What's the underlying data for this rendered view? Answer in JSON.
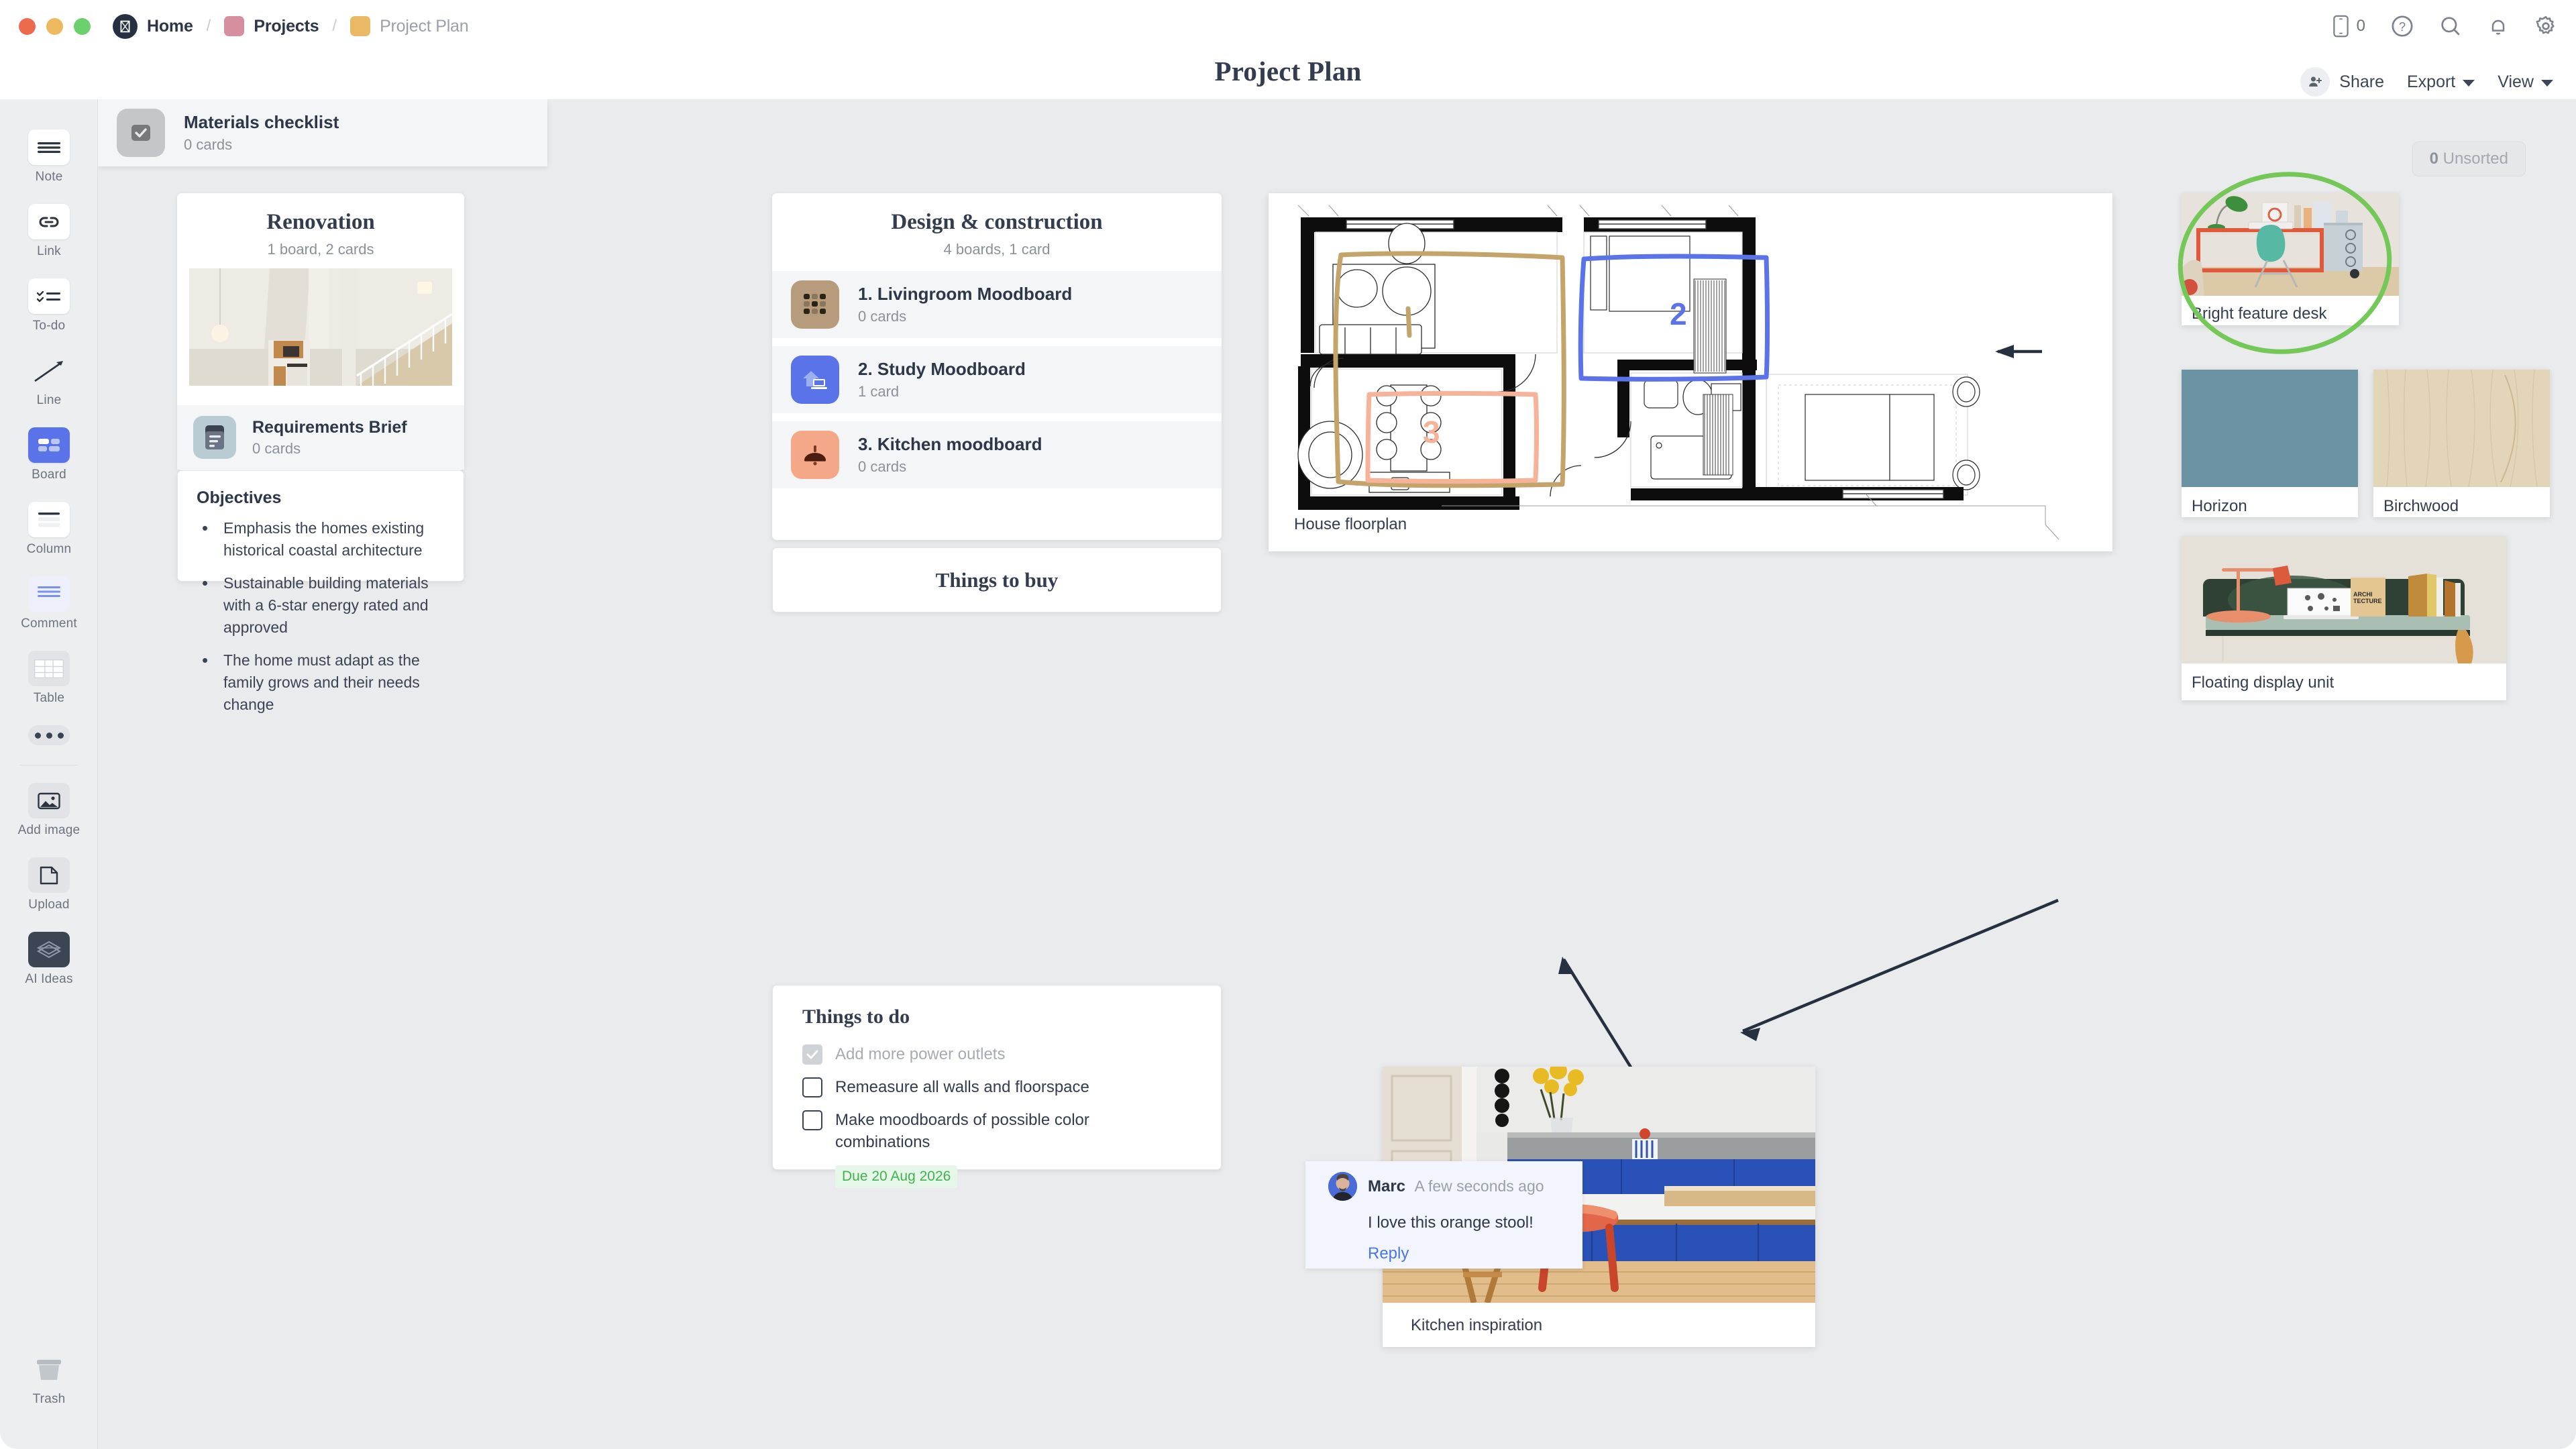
{
  "window": {
    "traffic_lights": [
      "close",
      "minimize",
      "maximize"
    ]
  },
  "breadcrumb": {
    "items": [
      {
        "label": "Home",
        "icon": "app-logo-icon",
        "color": "#263040",
        "dim": false
      },
      {
        "label": "Projects",
        "icon": "folder-square-icon",
        "color": "#d58f9e",
        "dim": false
      },
      {
        "label": "Project Plan",
        "icon": "folder-square-icon",
        "color": "#eab965",
        "dim": true
      }
    ],
    "separator": "/"
  },
  "topbar": {
    "device_count": "0",
    "icons": [
      "mobile-preview-icon",
      "help-icon",
      "search-icon",
      "notifications-icon",
      "settings-icon"
    ]
  },
  "header": {
    "title": "Project Plan",
    "share_label": "Share",
    "export_label": "Export",
    "view_label": "View"
  },
  "toolbar": {
    "items": [
      {
        "label": "Note",
        "icon": "note-icon",
        "active": false
      },
      {
        "label": "Link",
        "icon": "link-icon",
        "active": false
      },
      {
        "label": "To-do",
        "icon": "todo-icon",
        "active": false
      },
      {
        "label": "Line",
        "icon": "line-icon",
        "active": false
      },
      {
        "label": "Board",
        "icon": "board-icon",
        "active": true
      },
      {
        "label": "Column",
        "icon": "column-icon",
        "active": false
      },
      {
        "label": "Comment",
        "icon": "comment-icon",
        "active": false
      },
      {
        "label": "Table",
        "icon": "table-icon",
        "active": false
      }
    ],
    "more_label": "...",
    "items2": [
      {
        "label": "Add image",
        "icon": "image-icon"
      },
      {
        "label": "Upload",
        "icon": "upload-icon"
      },
      {
        "label": "AI Ideas",
        "icon": "ai-ideas-icon"
      }
    ],
    "trash_label": "Trash"
  },
  "canvas": {
    "unsorted_count": "0",
    "unsorted_label": "Unsorted",
    "background_color": "#eaebec"
  },
  "columns": {
    "renovation": {
      "title": "Renovation",
      "subtitle": "1 board, 2 cards",
      "photo_alt": "interior-stairwell-photo",
      "brief": {
        "name": "Requirements Brief",
        "count": "0 cards",
        "icon": "document-icon",
        "icon_bg": "#b9ccd4"
      },
      "objectives": {
        "title": "Objectives",
        "items": [
          "Emphasis the homes existing historical coastal architecture",
          "Sustainable building materials with a 6-star energy rated and approved",
          "The home must adapt as the family grows and their needs change"
        ]
      }
    },
    "design": {
      "title": "Design & construction",
      "subtitle": "4 boards, 1 card",
      "boards": [
        {
          "name": "1. Livingroom Moodboard",
          "count": "0 cards",
          "icon": "grid-icon",
          "icon_bg": "#b69b7c"
        },
        {
          "name": "2. Study Moodboard",
          "count": "1 card",
          "icon": "house-laptop-icon",
          "icon_bg": "#5a73e8"
        },
        {
          "name": "3. Kitchen moodboard",
          "count": "0 cards",
          "icon": "pendant-lamp-icon",
          "icon_bg": "#f4a888"
        }
      ]
    },
    "things_to_buy": {
      "title": "Things to buy",
      "materials": {
        "name": "Materials checklist",
        "count": "0 cards",
        "icon": "checkbox-icon",
        "icon_bg": "#c4c6c9"
      }
    },
    "things_to_do": {
      "title": "Things to do",
      "items": [
        {
          "text": "Add more power outlets",
          "checked": true
        },
        {
          "text": "Remeasure all walls and floorspace",
          "checked": false
        },
        {
          "text": "Make moodboards of possible color combinations",
          "checked": false
        }
      ],
      "due_label": "Due 20 Aug 2026",
      "due_color": "#3fb44f"
    }
  },
  "floorplan": {
    "caption": "House floorplan",
    "annotations": [
      {
        "label": "2",
        "color": "#5a73e8",
        "shape": "rounded-rect"
      },
      {
        "label": "3",
        "color": "#f6b39a",
        "shape": "rounded-rect"
      },
      {
        "label": "",
        "color": "#c4a46a",
        "shape": "freeform"
      }
    ]
  },
  "image_cards": [
    {
      "id": "desk",
      "caption": "Bright feature desk",
      "annotation": "green-circle",
      "annotation_color": "#74c857"
    },
    {
      "id": "horizon",
      "caption": "Horizon",
      "swatch_color": "#6c93a4"
    },
    {
      "id": "birch",
      "caption": "Birchwood",
      "swatch_color": "#e3d5b8"
    },
    {
      "id": "float",
      "caption": "Floating display unit"
    },
    {
      "id": "kitchen",
      "caption": "Kitchen inspiration"
    }
  ],
  "comment": {
    "author": "Marc",
    "time": "A few seconds ago",
    "body": "I love this orange stool!",
    "reply_label": "Reply"
  }
}
